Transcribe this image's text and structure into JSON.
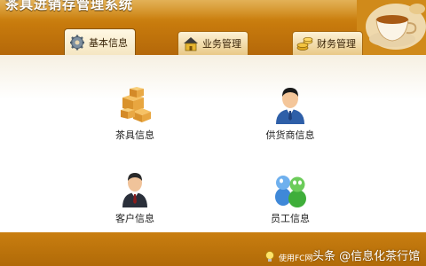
{
  "app": {
    "title": "茶具进销存管理系统"
  },
  "tabs": [
    {
      "label": "基本信息",
      "icon": "gear-icon",
      "active": true
    },
    {
      "label": "业务管理",
      "icon": "house-icon",
      "active": false
    },
    {
      "label": "财务管理",
      "icon": "coins-icon",
      "active": false
    }
  ],
  "items": [
    {
      "label": "茶具信息",
      "icon": "boxes-icon"
    },
    {
      "label": "供货商信息",
      "icon": "supplier-person-icon"
    },
    {
      "label": "客户信息",
      "icon": "customer-person-icon"
    },
    {
      "label": "员工信息",
      "icon": "employees-icon"
    }
  ],
  "footer": {
    "status_text": "使用FC网",
    "watermark": "头条 @信息化茶行馆"
  },
  "colors": {
    "header": "#c77a0c",
    "footer": "#b06a08",
    "tab_bg": "#f5e6c2"
  }
}
